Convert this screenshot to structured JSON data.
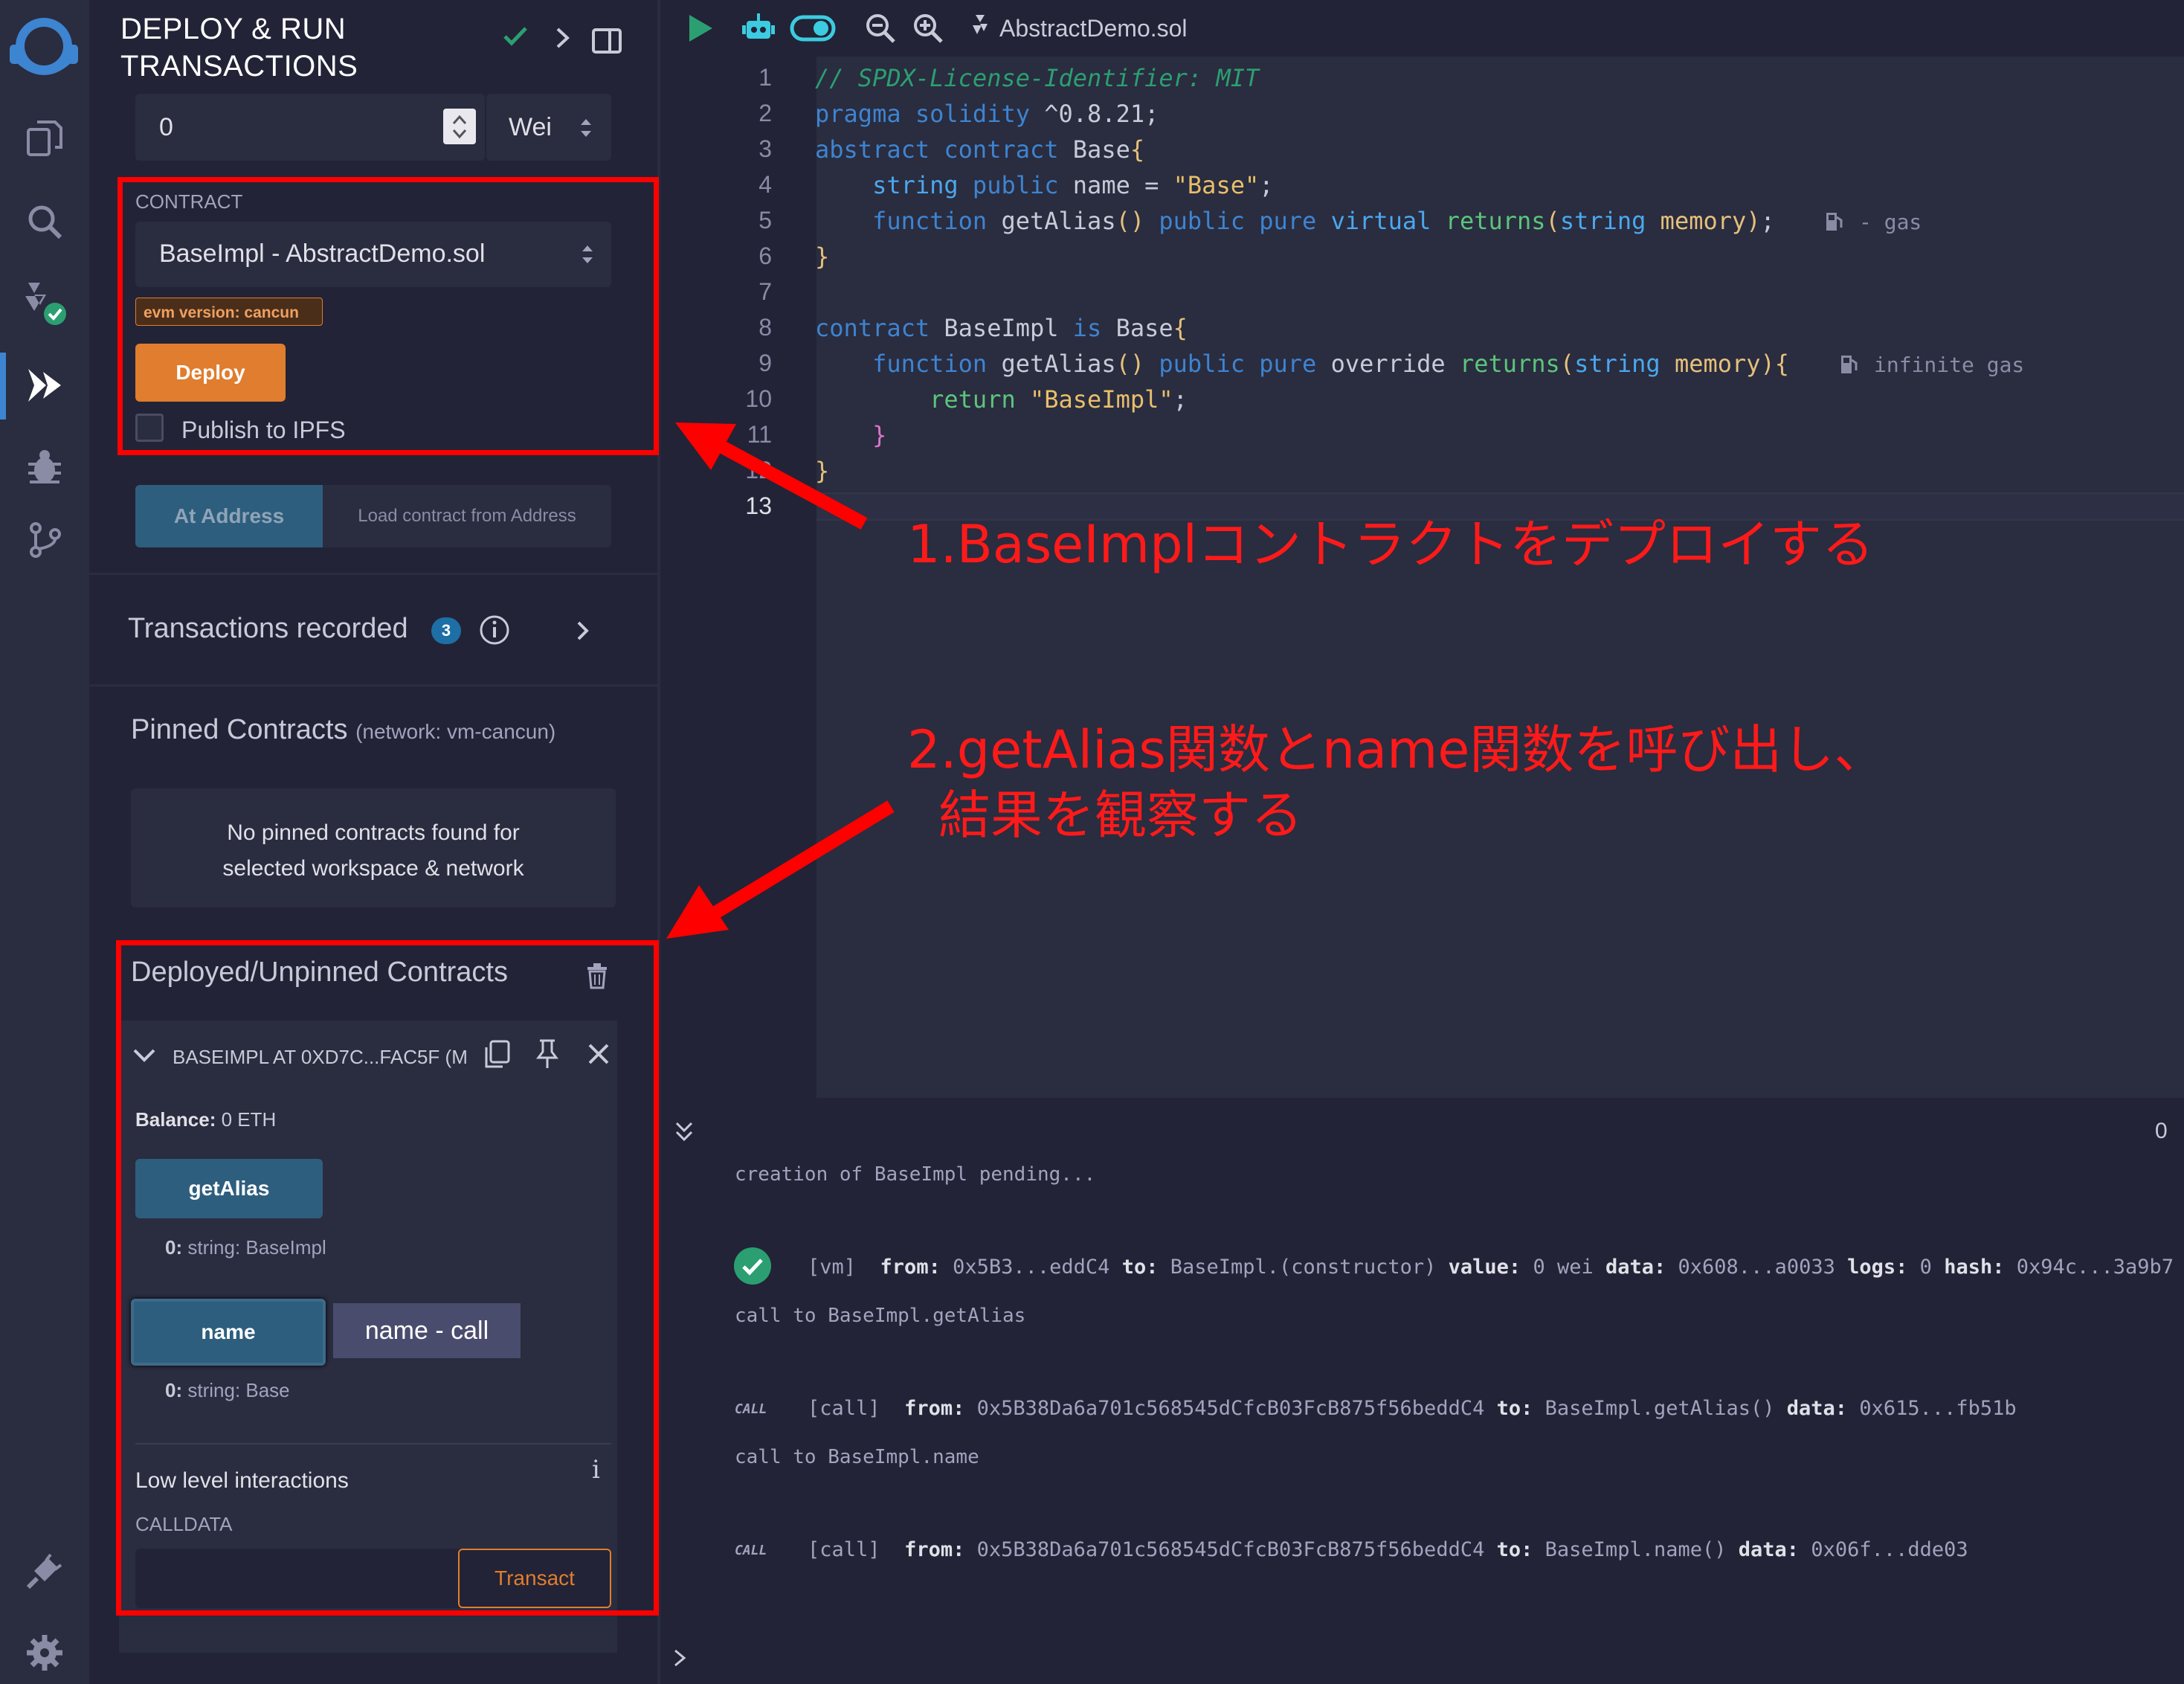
{
  "sidepanel": {
    "title_line1": "DEPLOY & RUN",
    "title_line2": "TRANSACTIONS",
    "value_input": "0",
    "value_unit": "Wei",
    "contract_label": "CONTRACT",
    "contract_selected": "BaseImpl - AbstractDemo.sol",
    "evm_badge": "evm version: cancun",
    "deploy_label": "Deploy",
    "publish_label": "Publish to IPFS",
    "at_address_label": "At Address",
    "load_address_placeholder": "Load contract from Address",
    "transactions_recorded_label": "Transactions recorded",
    "transactions_count": "3",
    "pinned_title": "Pinned Contracts",
    "pinned_network": "(network: vm-cancun)",
    "pinned_empty_line1": "No pinned contracts found for",
    "pinned_empty_line2": "selected workspace & network",
    "deployed_title": "Deployed/Unpinned Contracts",
    "instance_title": "BASEIMPL AT 0XD7C...FAC5F (M",
    "balance_label": "Balance:",
    "balance_value": "0 ETH",
    "fn_getalias": "getAlias",
    "fn_getalias_result_index": "0:",
    "fn_getalias_result": "string: BaseImpl",
    "fn_name": "name",
    "fn_name_tooltip": "name - call",
    "fn_name_result_index": "0:",
    "fn_name_result": "string: Base",
    "low_level_label": "Low level interactions",
    "calldata_label": "CALLDATA",
    "transact_label": "Transact"
  },
  "toolbar": {
    "filename": "AbstractDemo.sol"
  },
  "editor": {
    "line_numbers": [
      "1",
      "2",
      "3",
      "4",
      "5",
      "6",
      "7",
      "8",
      "9",
      "10",
      "11",
      "12",
      "13"
    ],
    "line1": "// SPDX-License-Identifier: MIT",
    "gas_hint_5": "- gas",
    "gas_hint_9": "infinite gas"
  },
  "terminal": {
    "counter": "0",
    "line1": "creation of BaseImpl pending...",
    "tx_tag": "[vm]",
    "tx_from_label": "from:",
    "tx_from": "0x5B3...eddC4",
    "tx_to_label": "to:",
    "tx_to": "BaseImpl.(constructor)",
    "tx_value_label": "value:",
    "tx_value": "0 wei",
    "tx_data_label": "data:",
    "tx_data": "0x608...a0033",
    "tx_logs_label": "logs:",
    "tx_logs": "0",
    "tx_hash_label": "hash:",
    "tx_hash": "0x94c...3a9b7",
    "call1_intro": "call to BaseImpl.getAlias",
    "call_tag": "CALL",
    "call_bracket": "[call]",
    "call1_from": "0x5B38Da6a701c568545dCfcB03FcB875f56beddC4",
    "call1_to": "BaseImpl.getAlias()",
    "call1_data": "0x615...fb51b",
    "call2_intro": "call to BaseImpl.name",
    "call2_from": "0x5B38Da6a701c568545dCfcB03FcB875f56beddC4",
    "call2_to": "BaseImpl.name()",
    "call2_data": "0x06f...dde03"
  },
  "annotations": {
    "step1": "1.BaseImplコントラクトをデプロイする",
    "step2_line1": "2.getAlias関数とname関数を呼び出し、",
    "step2_line2": "結果を観察する"
  },
  "colors": {
    "accent": "#3d84d1",
    "deploy": "#e07d2e",
    "annotation": "#ff0000"
  }
}
